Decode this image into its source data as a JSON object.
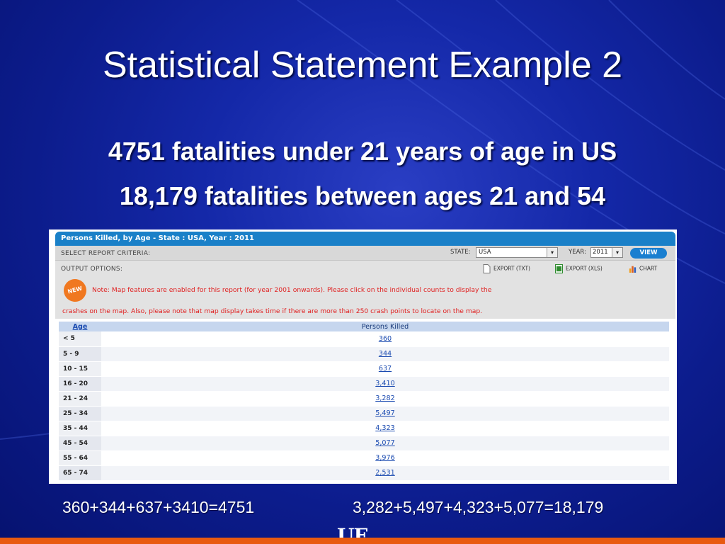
{
  "slide": {
    "title": "Statistical Statement Example 2",
    "line1": "4751 fatalities under 21 years of age in US",
    "line2": "18,179 fatalities between ages 21 and 54",
    "sum_left": "360+344+637+3410=4751",
    "sum_right": "3,282+5,497+4,323+5,077=18,179",
    "logo_text": "UF"
  },
  "report": {
    "header": "Persons Killed, by Age - State : USA, Year : 2011",
    "select_criteria_label": "SELECT REPORT CRITERIA:",
    "state_label": "STATE:",
    "state_value": "USA",
    "year_label": "YEAR:",
    "year_value": "2011",
    "view_label": "VIEW",
    "output_options_label": "OUTPUT OPTIONS:",
    "export_txt": "EXPORT (TXT)",
    "export_xls": "EXPORT (XLS)",
    "chart": "CHART",
    "new_badge": "NEW",
    "note_line1": "Note: Map features are enabled for this report (for year 2001 onwards). Please click on the individual counts to display the",
    "note_line2": "crashes on the map. Also, please note that map display takes time if there are more than 250 crash points to locate on the map.",
    "columns": [
      "Age",
      "Persons Killed"
    ],
    "rows": [
      {
        "age": "< 5",
        "killed": "360"
      },
      {
        "age": "5 - 9",
        "killed": "344"
      },
      {
        "age": "10 - 15",
        "killed": "637"
      },
      {
        "age": "16 - 20",
        "killed": "3,410"
      },
      {
        "age": "21 - 24",
        "killed": "3,282"
      },
      {
        "age": "25 - 34",
        "killed": "5,497"
      },
      {
        "age": "35 - 44",
        "killed": "4,323"
      },
      {
        "age": "45 - 54",
        "killed": "5,077"
      },
      {
        "age": "55 - 64",
        "killed": "3,976"
      },
      {
        "age": "65 - 74",
        "killed": "2,531"
      }
    ]
  },
  "colors": {
    "background": "#1428a8",
    "header_blue": "#1a80c8",
    "note_red": "#e02020",
    "link_blue": "#1a4ab0",
    "bottom_bar": "#e85a10"
  }
}
